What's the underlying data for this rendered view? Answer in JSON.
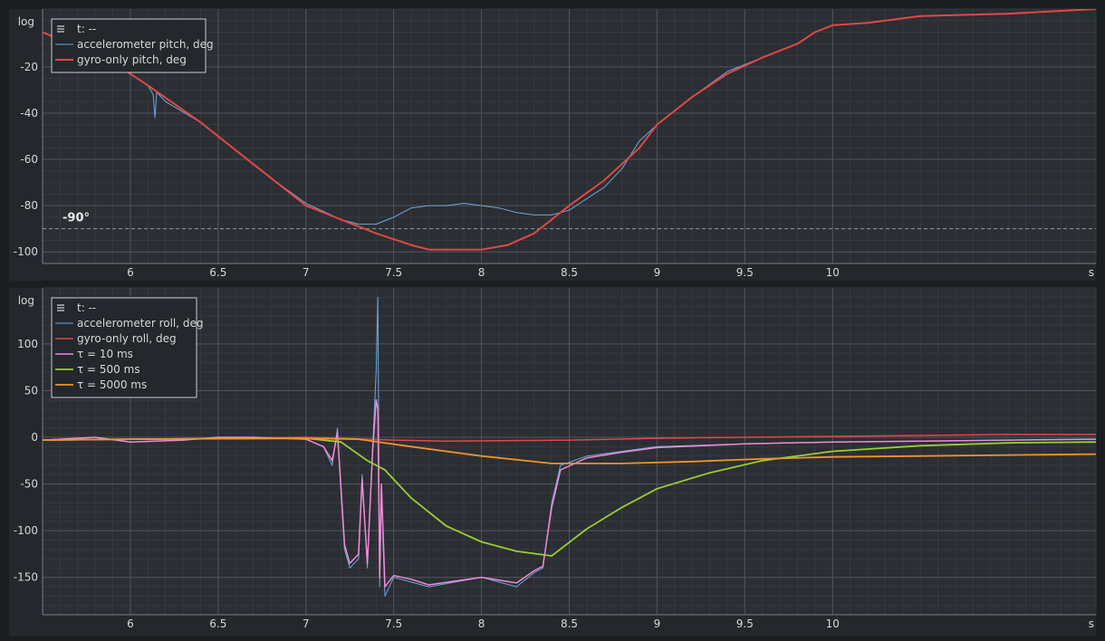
{
  "chart_data": [
    {
      "type": "line",
      "y_corner_label": "log",
      "x_unit_label": "s",
      "xlim": [
        5.5,
        11.5
      ],
      "ylim": [
        -105,
        5
      ],
      "x_ticks": [
        6,
        6.5,
        7,
        7.5,
        8,
        8.5,
        9,
        9.5,
        10
      ],
      "x_tick_labels": [
        "6",
        "6.5",
        "7",
        "7.5",
        "8",
        "8.5",
        "9",
        "9.5",
        "10"
      ],
      "y_ticks": [
        -20,
        -40,
        -60,
        -80,
        -100
      ],
      "y_tick_labels": [
        "-20",
        "-40",
        "-60",
        "-80",
        "-100"
      ],
      "grid": true,
      "legend_placement": "top-left",
      "legend_header": "t: --",
      "reference_line": {
        "y": -90,
        "label": "-90°",
        "color": "#8f949b"
      },
      "series": [
        {
          "name": "accelerometer pitch, deg",
          "color": "#6fa8dc",
          "width": 1,
          "x": [
            5.5,
            5.9,
            6.1,
            6.13,
            6.14,
            6.15,
            6.2,
            6.4,
            6.6,
            6.8,
            7.0,
            7.2,
            7.3,
            7.4,
            7.5,
            7.6,
            7.7,
            7.8,
            7.9,
            8.0,
            8.1,
            8.2,
            8.3,
            8.4,
            8.5,
            8.7,
            8.8,
            8.9,
            9.0,
            9.2,
            9.4,
            9.6,
            9.8,
            9.9,
            10.0,
            10.2,
            10.5,
            11.0,
            11.5
          ],
          "y": [
            -5,
            -18,
            -28,
            -32,
            -42,
            -31,
            -35,
            -44,
            -56,
            -68,
            -79,
            -86,
            -88,
            -88,
            -85,
            -81,
            -80,
            -80,
            -79,
            -80,
            -81,
            -83,
            -84,
            -84,
            -82,
            -72,
            -64,
            -52,
            -45,
            -33,
            -22,
            -16,
            -10,
            -5,
            -2,
            -1,
            2,
            3,
            5
          ]
        },
        {
          "name": "gyro-only pitch, deg",
          "color": "#e04848",
          "width": 2,
          "x": [
            5.5,
            5.9,
            6.1,
            6.4,
            6.7,
            7.0,
            7.2,
            7.4,
            7.6,
            7.7,
            7.8,
            8.0,
            8.15,
            8.3,
            8.5,
            8.7,
            8.9,
            9.0,
            9.2,
            9.4,
            9.6,
            9.8,
            9.9,
            10.0,
            10.2,
            10.5,
            11.0,
            11.5
          ],
          "y": [
            -5,
            -18,
            -28,
            -44,
            -62,
            -80,
            -86,
            -92,
            -97,
            -99,
            -99,
            -99,
            -97,
            -92,
            -80,
            -69,
            -55,
            -45,
            -33,
            -23,
            -16,
            -10,
            -5,
            -2,
            -1,
            2,
            3,
            5
          ]
        }
      ]
    },
    {
      "type": "line",
      "y_corner_label": "log",
      "x_unit_label": "s",
      "xlim": [
        5.5,
        11.5
      ],
      "ylim": [
        -190,
        160
      ],
      "x_ticks": [
        6,
        6.5,
        7,
        7.5,
        8,
        8.5,
        9,
        9.5,
        10
      ],
      "x_tick_labels": [
        "6",
        "6.5",
        "7",
        "7.5",
        "8",
        "8.5",
        "9",
        "9.5",
        "10"
      ],
      "y_ticks": [
        100,
        50,
        0,
        -50,
        -100,
        -150
      ],
      "y_tick_labels": [
        "100",
        "50",
        "0",
        "-50",
        "-100",
        "-150"
      ],
      "grid": true,
      "legend_placement": "top-left",
      "legend_header": "t: --",
      "series": [
        {
          "name": "accelerometer roll, deg",
          "color": "#6fa8dc",
          "width": 1,
          "x": [
            5.5,
            5.8,
            6.0,
            6.3,
            6.5,
            6.7,
            7.0,
            7.1,
            7.15,
            7.18,
            7.2,
            7.22,
            7.25,
            7.3,
            7.32,
            7.35,
            7.38,
            7.4,
            7.41,
            7.42,
            7.43,
            7.45,
            7.5,
            7.6,
            7.7,
            8.0,
            8.2,
            8.3,
            8.35,
            8.4,
            8.45,
            8.6,
            8.8,
            9.0,
            9.5,
            10.0,
            10.5,
            11.0,
            11.5
          ],
          "y": [
            -3,
            0,
            -5,
            -3,
            0,
            0,
            -2,
            -10,
            -30,
            10,
            -60,
            -120,
            -140,
            -130,
            -40,
            -140,
            -10,
            70,
            150,
            -160,
            -60,
            -170,
            -150,
            -155,
            -160,
            -150,
            -160,
            -145,
            -140,
            -70,
            -30,
            -20,
            -15,
            -10,
            -7,
            -5,
            -4,
            -3,
            -2
          ]
        },
        {
          "name": "gyro-only roll, deg",
          "color": "#e04848",
          "width": 1.5,
          "x": [
            5.5,
            6.0,
            7.0,
            7.2,
            7.5,
            7.8,
            8.5,
            9.0,
            9.5,
            10.0,
            10.5,
            11.0,
            11.5
          ],
          "y": [
            -3,
            -2,
            0,
            -1,
            -3,
            -4,
            -3,
            -1,
            0,
            1,
            2,
            3,
            3
          ]
        },
        {
          "name": "τ = 10 ms",
          "color": "#f08ad8",
          "width": 1.5,
          "x": [
            5.5,
            5.8,
            6.0,
            6.3,
            6.5,
            6.7,
            7.0,
            7.1,
            7.15,
            7.18,
            7.2,
            7.22,
            7.25,
            7.3,
            7.32,
            7.35,
            7.38,
            7.4,
            7.41,
            7.42,
            7.43,
            7.45,
            7.5,
            7.6,
            7.7,
            8.0,
            8.2,
            8.3,
            8.35,
            8.4,
            8.45,
            8.6,
            8.8,
            9.0,
            9.5,
            10.0,
            10.5,
            11.0,
            11.5
          ],
          "y": [
            -3,
            0,
            -5,
            -3,
            0,
            0,
            -2,
            -10,
            -25,
            5,
            -55,
            -115,
            -135,
            -125,
            -45,
            -135,
            -15,
            40,
            30,
            -150,
            -50,
            -160,
            -148,
            -152,
            -158,
            -150,
            -156,
            -143,
            -138,
            -75,
            -35,
            -22,
            -16,
            -11,
            -7,
            -5,
            -4,
            -3,
            -2
          ]
        },
        {
          "name": "τ = 500 ms",
          "color": "#9acd32",
          "width": 1.8,
          "x": [
            5.5,
            6.0,
            7.0,
            7.2,
            7.35,
            7.45,
            7.6,
            7.8,
            8.0,
            8.2,
            8.4,
            8.6,
            8.8,
            9.0,
            9.3,
            9.6,
            10.0,
            10.5,
            11.0,
            11.5
          ],
          "y": [
            -3,
            -2,
            -1,
            -5,
            -25,
            -35,
            -65,
            -95,
            -112,
            -122,
            -127,
            -98,
            -75,
            -55,
            -38,
            -25,
            -15,
            -9,
            -6,
            -5
          ]
        },
        {
          "name": "τ = 5000 ms",
          "color": "#f0922a",
          "width": 1.8,
          "x": [
            5.5,
            6.0,
            7.0,
            7.3,
            7.6,
            8.0,
            8.4,
            8.8,
            9.2,
            9.6,
            10.0,
            10.5,
            11.0,
            11.5
          ],
          "y": [
            -3,
            -2,
            -1,
            -2,
            -10,
            -20,
            -28,
            -28,
            -26,
            -23,
            -21,
            -20,
            -19,
            -18
          ]
        }
      ]
    }
  ]
}
